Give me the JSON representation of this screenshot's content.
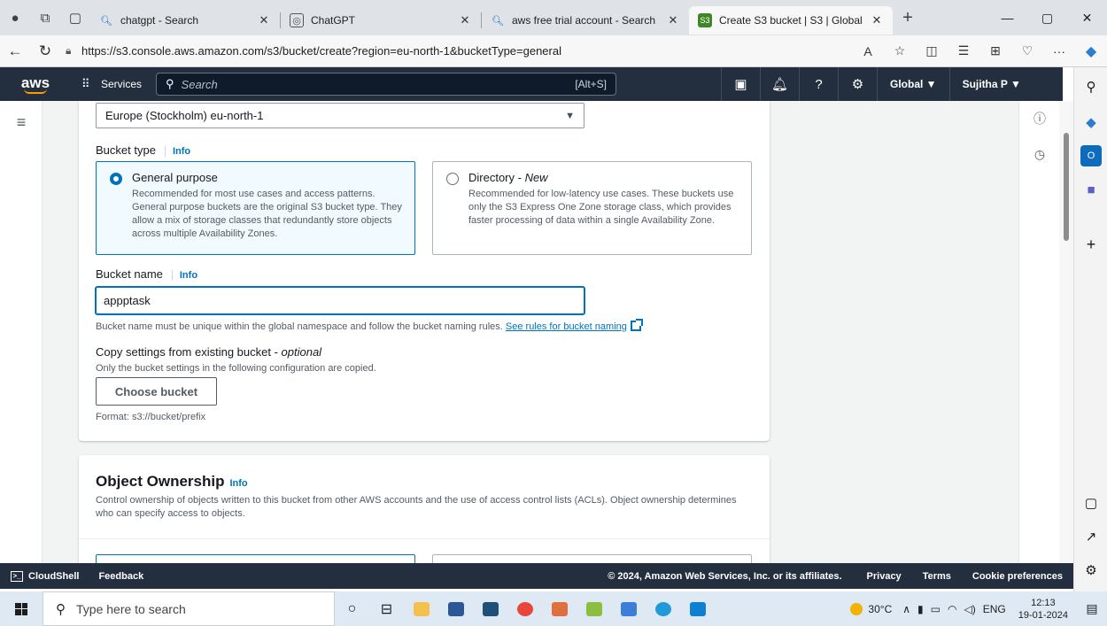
{
  "browser": {
    "tabs": [
      {
        "title": "chatgpt - Search",
        "icon": "search-icon"
      },
      {
        "title": "ChatGPT",
        "icon": "chatgpt-icon"
      },
      {
        "title": "aws free trial account - Search",
        "icon": "search-icon"
      },
      {
        "title": "Create S3 bucket | S3 | Global",
        "icon": "s3-icon",
        "active": true
      }
    ],
    "new_tab": "+",
    "url": "https://s3.console.aws.amazon.com/s3/bucket/create?region=eu-north-1&bucketType=general",
    "window": {
      "minimize": "—",
      "restore": "▢",
      "close": "✕"
    }
  },
  "aws_nav": {
    "logo": "aws",
    "services_label": "Services",
    "search_placeholder": "Search",
    "search_shortcut": "[Alt+S]",
    "region_label": "Global ▼",
    "account_label": "Sujitha P ▼"
  },
  "general": {
    "region_value": "Europe (Stockholm) eu-north-1",
    "bucket_type_label": "Bucket type",
    "info": "Info",
    "tiles": {
      "general": {
        "title": "General purpose",
        "desc": "Recommended for most use cases and access patterns. General purpose buckets are the original S3 bucket type. They allow a mix of storage classes that redundantly store objects across multiple Availability Zones."
      },
      "directory": {
        "title": "Directory - ",
        "title_badge": "New",
        "desc": "Recommended for low-latency use cases. These buckets use only the S3 Express One Zone storage class, which provides faster processing of data within a single Availability Zone."
      }
    },
    "bucket_name_label": "Bucket name",
    "bucket_name_value": "appptask",
    "bucket_name_hint": "Bucket name must be unique within the global namespace and follow the bucket naming rules.",
    "naming_rules_link": "See rules for bucket naming",
    "copy_title": "Copy settings from existing bucket - ",
    "copy_title_optional": "optional",
    "copy_desc": "Only the bucket settings in the following configuration are copied.",
    "choose_bucket": "Choose bucket",
    "format_hint": "Format: s3://bucket/prefix"
  },
  "ownership": {
    "title": "Object Ownership",
    "info": "Info",
    "desc": "Control ownership of objects written to this bucket from other AWS accounts and the use of access control lists (ACLs). Object ownership determines who can specify access to objects."
  },
  "footer": {
    "cloudshell": "CloudShell",
    "feedback": "Feedback",
    "copyright": "© 2024, Amazon Web Services, Inc. or its affiliates.",
    "privacy": "Privacy",
    "terms": "Terms",
    "cookies": "Cookie preferences"
  },
  "taskbar": {
    "search_placeholder": "Type here to search",
    "temperature": "30°C",
    "lang": "ENG",
    "time": "12:13",
    "date": "19-01-2024"
  },
  "colors": {
    "aws_nav": "#232f3e",
    "aws_orange": "#ff9900",
    "link_blue": "#0073bb",
    "console_bg": "#f2f3f3"
  }
}
